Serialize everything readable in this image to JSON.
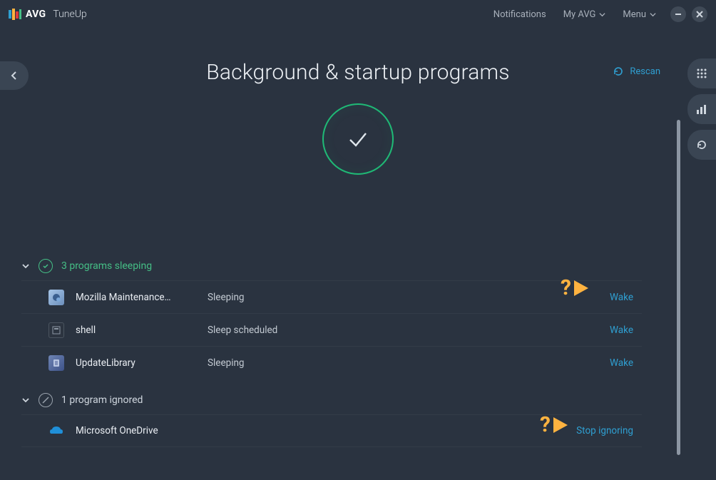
{
  "header": {
    "brand": "AVG",
    "product": "TuneUp",
    "notifications": "Notifications",
    "my_avg": "My AVG",
    "menu": "Menu"
  },
  "page": {
    "title": "Background & startup programs",
    "rescan": "Rescan"
  },
  "sections": {
    "sleeping": {
      "label": "3 programs sleeping",
      "items": [
        {
          "name": "Mozilla Maintenance…",
          "status": "Sleeping",
          "action": "Wake"
        },
        {
          "name": "shell",
          "status": "Sleep scheduled",
          "action": "Wake"
        },
        {
          "name": "UpdateLibrary",
          "status": "Sleeping",
          "action": "Wake"
        }
      ]
    },
    "ignored": {
      "label": "1 program ignored",
      "items": [
        {
          "name": "Microsoft OneDrive",
          "status": "",
          "action": "Stop ignoring"
        }
      ]
    }
  }
}
